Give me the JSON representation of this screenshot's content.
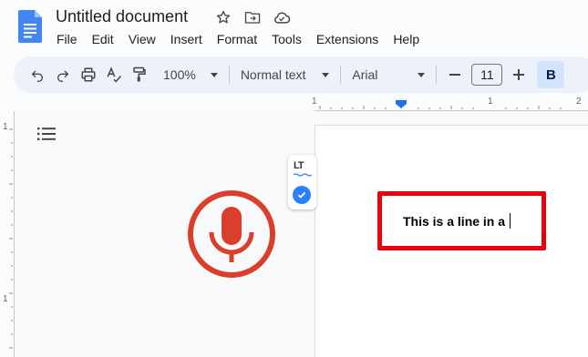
{
  "document": {
    "title": "Untitled document",
    "body_text": "This is a line in a "
  },
  "menu": [
    "File",
    "Edit",
    "View",
    "Insert",
    "Format",
    "Tools",
    "Extensions",
    "Help"
  ],
  "toolbar": {
    "zoom": "100%",
    "style": "Normal text",
    "font": "Arial",
    "font_size": "11",
    "bold_label": "B"
  },
  "ruler": {
    "h_labels": [
      "1",
      "1",
      "2"
    ],
    "v_labels": [
      "1",
      "1"
    ]
  },
  "extension": {
    "logo_text": "LT"
  },
  "colors": {
    "accent": "#1a73e8",
    "mic": "#d93f2b",
    "highlight": "#e8000b",
    "toolbar_bg": "#edf2fa"
  },
  "icons": [
    "docs-logo-icon",
    "star-icon",
    "move-folder-icon",
    "cloud-status-icon",
    "undo-icon",
    "redo-icon",
    "print-icon",
    "spellcheck-icon",
    "paint-format-icon",
    "outline-icon",
    "microphone-icon",
    "languagetool-icon",
    "check-icon"
  ]
}
